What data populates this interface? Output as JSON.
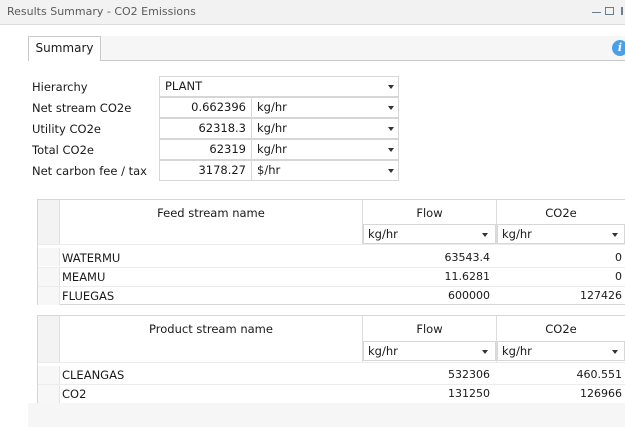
{
  "window": {
    "title": "Results Summary - CO2 Emissions",
    "controls": [
      "minimize-icon",
      "maximize-icon",
      "close-icon"
    ]
  },
  "tabs": [
    {
      "label": "Summary",
      "selected": true
    }
  ],
  "info_icon": "info-icon",
  "fields": {
    "hierarchy": {
      "label": "Hierarchy",
      "value": "PLANT"
    },
    "net_stream": {
      "label": "Net stream CO2e",
      "value": "0.662396",
      "unit": "kg/hr"
    },
    "utility": {
      "label": "Utility CO2e",
      "value": "62318.3",
      "unit": "kg/hr"
    },
    "total": {
      "label": "Total CO2e",
      "value": "62319",
      "unit": "kg/hr"
    },
    "carbon_fee": {
      "label": "Net carbon fee / tax",
      "value": "3178.27",
      "unit": "$/hr"
    }
  },
  "feed_table": {
    "name_header": "Feed stream name",
    "flow_header": "Flow",
    "co2e_header": "CO2e",
    "flow_unit": "kg/hr",
    "co2e_unit": "kg/hr",
    "rows": [
      {
        "name": "WATERMU",
        "flow": "63543.4",
        "co2e": "0"
      },
      {
        "name": "MEAMU",
        "flow": "11.6281",
        "co2e": "0"
      },
      {
        "name": "FLUEGAS",
        "flow": "600000",
        "co2e": "127426"
      }
    ]
  },
  "product_table": {
    "name_header": "Product stream name",
    "flow_header": "Flow",
    "co2e_header": "CO2e",
    "flow_unit": "kg/hr",
    "co2e_unit": "kg/hr",
    "rows": [
      {
        "name": "CLEANGAS",
        "flow": "532306",
        "co2e": "460.551"
      },
      {
        "name": "CO2",
        "flow": "131250",
        "co2e": "126966"
      }
    ]
  }
}
